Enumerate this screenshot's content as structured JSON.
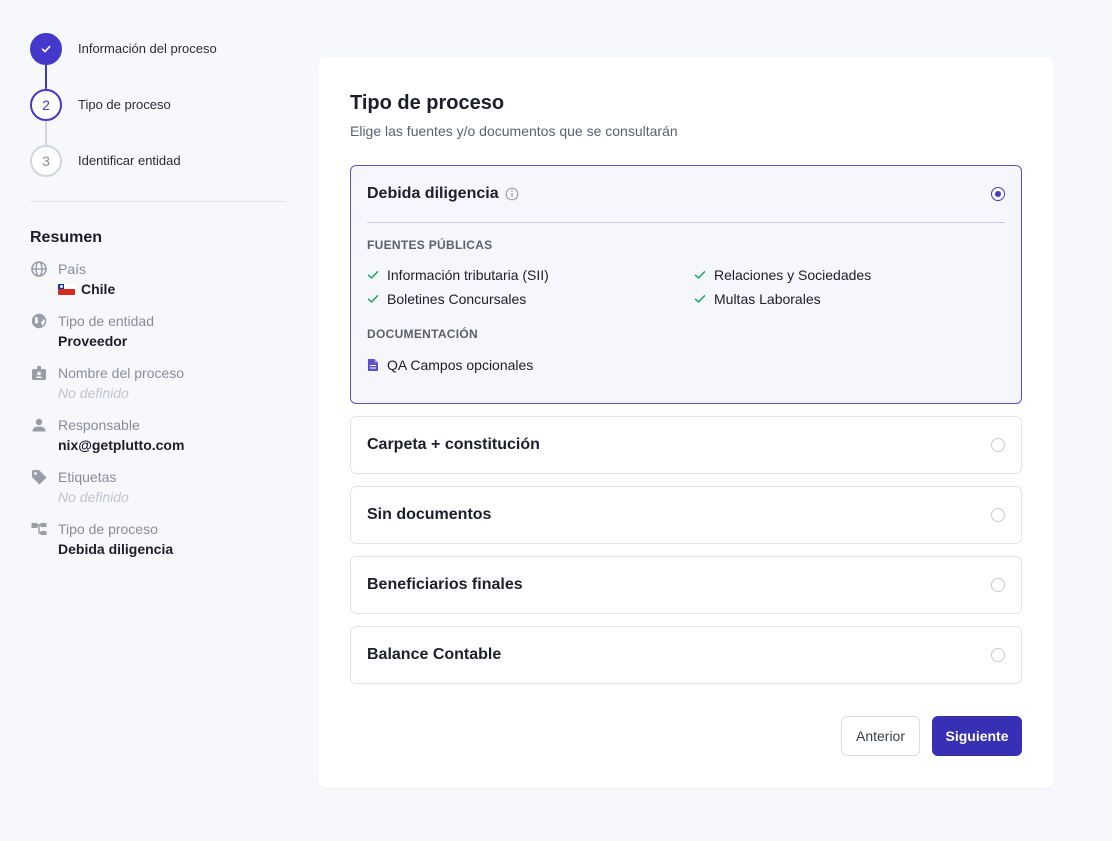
{
  "stepper": {
    "steps": [
      {
        "number": "1",
        "label": "Información del proceso",
        "state": "done"
      },
      {
        "number": "2",
        "label": "Tipo de proceso",
        "state": "current"
      },
      {
        "number": "3",
        "label": "Identificar entidad",
        "state": "todo"
      }
    ]
  },
  "summary": {
    "title": "Resumen",
    "items": [
      {
        "icon": "globe-icon",
        "label": "País",
        "value": "Chile",
        "flag": "chile-flag"
      },
      {
        "icon": "globe-filled-icon",
        "label": "Tipo de entidad",
        "value": "Proveedor"
      },
      {
        "icon": "badge-icon",
        "label": "Nombre del proceso",
        "value": "No definido",
        "empty": true
      },
      {
        "icon": "person-icon",
        "label": "Responsable",
        "value": "nix@getplutto.com"
      },
      {
        "icon": "tag-icon",
        "label": "Etiquetas",
        "value": "No definido",
        "empty": true
      },
      {
        "icon": "process-tree-icon",
        "label": "Tipo de proceso",
        "value": "Debida diligencia"
      }
    ]
  },
  "main": {
    "title": "Tipo de proceso",
    "subtitle": "Elige las fuentes y/o documentos que se consultarán",
    "options": [
      {
        "name": "Debida diligencia",
        "selected": true,
        "public_sources_heading": "FUENTES PÚBLICAS",
        "public_sources": [
          "Información tributaria (SII)",
          "Relaciones y Sociedades",
          "Boletines Concursales",
          "Multas Laborales"
        ],
        "documentation_heading": "DOCUMENTACIÓN",
        "documents": [
          "QA Campos opcionales"
        ]
      },
      {
        "name": "Carpeta + constitución",
        "selected": false
      },
      {
        "name": "Sin documentos",
        "selected": false
      },
      {
        "name": "Beneficiarios finales",
        "selected": false
      },
      {
        "name": "Balance Contable",
        "selected": false
      }
    ]
  },
  "actions": {
    "prev_label": "Anterior",
    "next_label": "Siguiente"
  },
  "colors": {
    "accent": "#4338ca",
    "check": "#22a55a",
    "background": "#f7f8fc"
  }
}
